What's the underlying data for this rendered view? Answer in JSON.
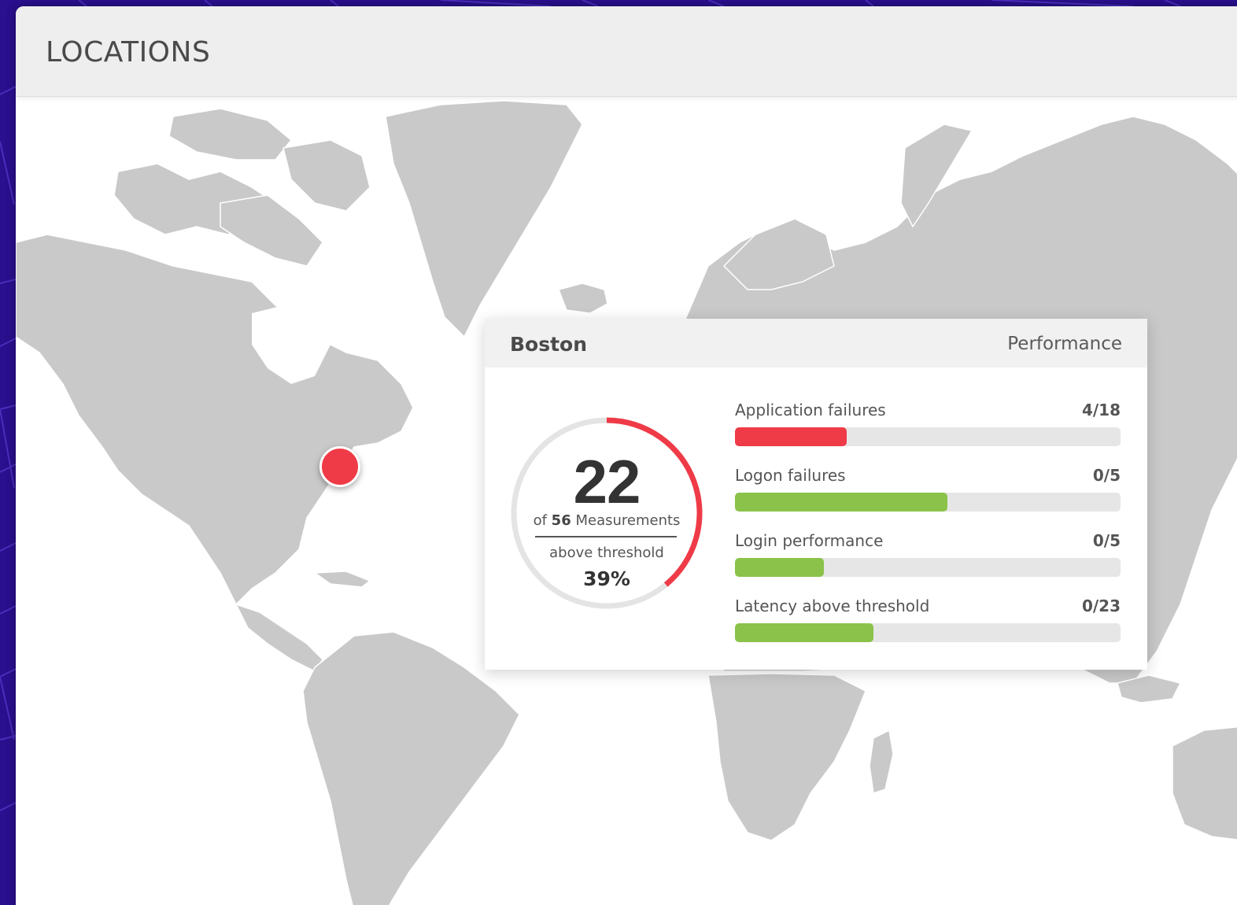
{
  "header": {
    "title": "LOCATIONS"
  },
  "map": {
    "marker": {
      "color": "#ef3b47"
    }
  },
  "card": {
    "city": "Boston",
    "tab": "Performance",
    "gauge": {
      "count": "22",
      "of_prefix": "of",
      "total": "56",
      "of_suffix": "Measurements",
      "above_label": "above threshold",
      "percent": "39%",
      "fraction": 0.39,
      "color": "#ef3b47"
    },
    "metrics": [
      {
        "label": "Application failures",
        "value": "4/18",
        "fill_fraction": 0.29,
        "color": "#ef3b47"
      },
      {
        "label": "Logon failures",
        "value": "0/5",
        "fill_fraction": 0.55,
        "color": "#8bc34a"
      },
      {
        "label": "Login performance",
        "value": "0/5",
        "fill_fraction": 0.23,
        "color": "#8bc34a"
      },
      {
        "label": "Latency above threshold",
        "value": "0/23",
        "fill_fraction": 0.36,
        "color": "#8bc34a"
      }
    ]
  }
}
